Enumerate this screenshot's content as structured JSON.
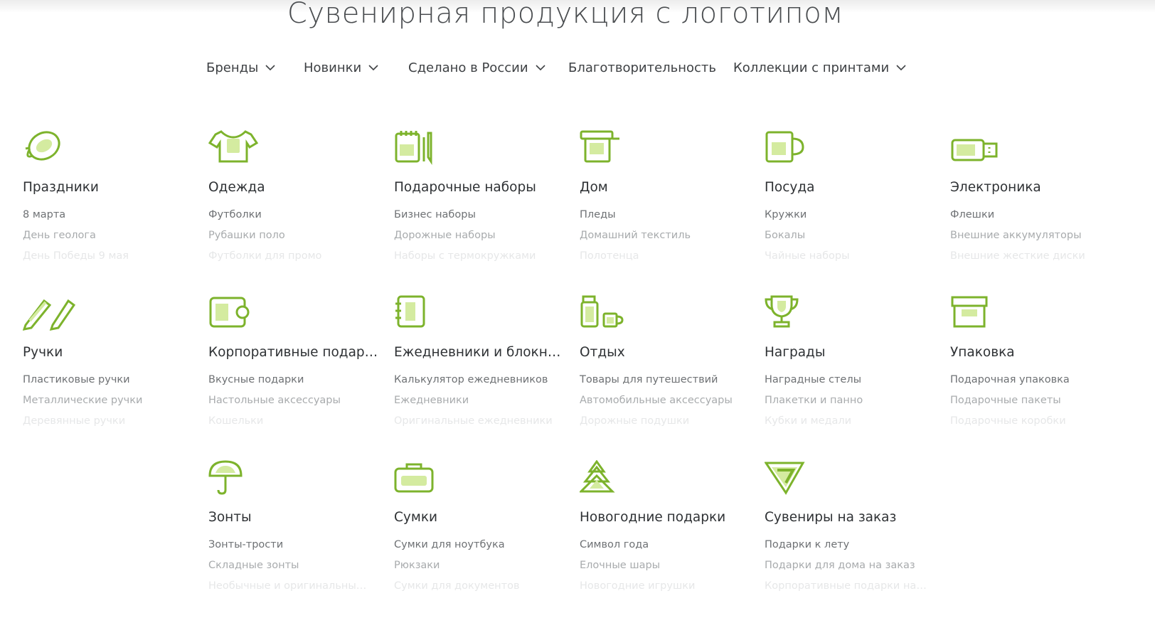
{
  "page": {
    "title": "Сувенирная продукция с логотипом"
  },
  "nav": [
    {
      "label": "Бренды",
      "dropdown": true
    },
    {
      "label": "Новинки",
      "dropdown": true
    },
    {
      "label": "Сделано в России",
      "dropdown": true
    },
    {
      "label": "Благотворительность",
      "dropdown": false
    },
    {
      "label": "Коллекции с принтами",
      "dropdown": true
    }
  ],
  "colors": {
    "accent": "#7db32c",
    "accent_fill": "#d4eba0",
    "title": "#4a4d50",
    "text": "#3c3f42"
  },
  "categories": [
    {
      "icon": "balloon-icon",
      "title": "Праздники",
      "items": [
        "8 марта",
        "День геолога",
        "День Победы 9 мая"
      ]
    },
    {
      "icon": "tshirt-icon",
      "title": "Одежда",
      "items": [
        "Футболки",
        "Рубашки поло",
        "Футболки для промо"
      ]
    },
    {
      "icon": "notebook-pen-icon",
      "title": "Подарочные наборы",
      "items": [
        "Бизнес наборы",
        "Дорожные наборы",
        "Наборы с термокружками"
      ]
    },
    {
      "icon": "home-textile-icon",
      "title": "Дом",
      "items": [
        "Пледы",
        "Домашний текстиль",
        "Полотенца"
      ]
    },
    {
      "icon": "mug-icon",
      "title": "Посуда",
      "items": [
        "Кружки",
        "Бокалы",
        "Чайные наборы"
      ]
    },
    {
      "icon": "usb-flash-icon",
      "title": "Электроника",
      "items": [
        "Флешки",
        "Внешние аккумуляторы",
        "Внешние жесткие диски"
      ]
    },
    {
      "icon": "pens-icon",
      "title": "Ручки",
      "items": [
        "Пластиковые ручки",
        "Металлические ручки",
        "Деревянные ручки"
      ]
    },
    {
      "icon": "wallet-icon",
      "title": "Корпоративные подарки",
      "items": [
        "Вкусные подарки",
        "Настольные аксессуары",
        "Кошельки"
      ]
    },
    {
      "icon": "planner-icon",
      "title": "Ежедневники и блокноты",
      "items": [
        "Калькулятор ежедневников",
        "Ежедневники",
        "Оригинальные ежедневники"
      ]
    },
    {
      "icon": "thermos-cup-icon",
      "title": "Отдых",
      "items": [
        "Товары для путешествий",
        "Автомобильные аксессуары",
        "Дорожные подушки"
      ]
    },
    {
      "icon": "trophy-icon",
      "title": "Награды",
      "items": [
        "Наградные стелы",
        "Плакетки и панно",
        "Кубки и медали"
      ]
    },
    {
      "icon": "gift-box-icon",
      "title": "Упаковка",
      "items": [
        "Подарочная упаковка",
        "Подарочные пакеты",
        "Подарочные коробки"
      ]
    },
    {
      "icon": "umbrella-icon",
      "title": "Зонты",
      "items": [
        "Зонты-трости",
        "Складные зонты",
        "Необычные и оригинальные зонты"
      ]
    },
    {
      "icon": "bag-icon",
      "title": "Сумки",
      "items": [
        "Сумки для ноутбука",
        "Рюкзаки",
        "Сумки для документов"
      ]
    },
    {
      "icon": "fir-tree-icon",
      "title": "Новогодние подарки",
      "items": [
        "Символ года",
        "Елочные шары",
        "Новогодние игрушки"
      ]
    },
    {
      "icon": "custom-logo-icon",
      "title": "Сувениры на заказ",
      "items": [
        "Подарки к лету",
        "Подарки для дома на заказ",
        "Корпоративные подарки на заказ"
      ]
    }
  ]
}
